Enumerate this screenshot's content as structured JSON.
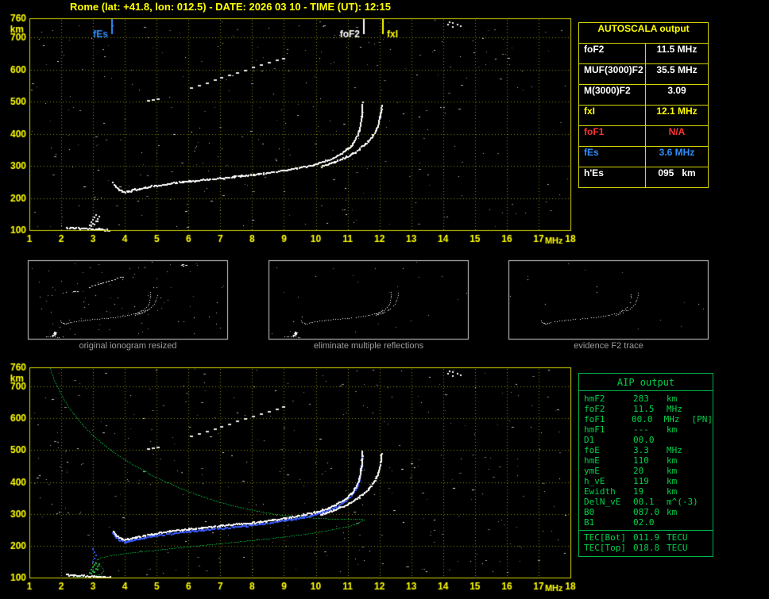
{
  "title": "Rome (lat: +41.8, lon: 012.5) - DATE: 2026 03 10 - TIME (UT): 12:15",
  "colors": {
    "axis_yellow": "#ffff00",
    "trace_white": "#ffffff",
    "profile_green": "#00d24a",
    "marker_blue": "#2f8fff",
    "error_red": "#ff3232",
    "caption_gray": "#9c9c9c"
  },
  "autoscala": {
    "header": "AUTOSCALA output",
    "rows": [
      {
        "label": "foF2",
        "value": "11.5 MHz",
        "color": "#ffffff"
      },
      {
        "label": "MUF(3000)F2",
        "value": "35.5 MHz",
        "color": "#ffffff"
      },
      {
        "label": "M(3000)F2",
        "value": "3.09",
        "color": "#ffffff"
      },
      {
        "label": "fxI",
        "value": "12.1 MHz",
        "color": "#ffff00"
      },
      {
        "label": "foF1",
        "value": "N/A",
        "color": "#ff3232"
      },
      {
        "label": "fEs",
        "value": "3.6 MHz",
        "color": "#2f8fff"
      },
      {
        "label": "h'Es",
        "value": "095   km",
        "color": "#ffffff"
      }
    ]
  },
  "aip": {
    "header": "AIP output",
    "rows": [
      {
        "label": "hmF2",
        "value": "283",
        "unit": "km"
      },
      {
        "label": "foF2",
        "value": "11.5",
        "unit": "MHz"
      },
      {
        "label": "foF1",
        "value": "00.0",
        "unit": "MHz",
        "extra": "[PN]"
      },
      {
        "label": "hmF1",
        "value": "---",
        "unit": "km"
      },
      {
        "label": "D1",
        "value": "00.0",
        "unit": ""
      },
      {
        "label": "foE",
        "value": "3.3",
        "unit": "MHz"
      },
      {
        "label": "hmE",
        "value": "110",
        "unit": "km"
      },
      {
        "label": "ymE",
        "value": "20",
        "unit": "km"
      },
      {
        "label": "h_vE",
        "value": "119",
        "unit": "km"
      },
      {
        "label": "Ewidth",
        "value": "19",
        "unit": "km"
      },
      {
        "label": "DelN_vE",
        "value": "00.1",
        "unit": "m^(-3)"
      },
      {
        "label": "B0",
        "value": "087.0",
        "unit": "km"
      },
      {
        "label": "B1",
        "value": "02.0",
        "unit": ""
      }
    ],
    "tec_rows": [
      {
        "label": "TEC[Bot]",
        "value": "011.9",
        "unit": "TECU"
      },
      {
        "label": "TEC[Top]",
        "value": "018.8",
        "unit": "TECU"
      }
    ]
  },
  "thumbnails": [
    {
      "caption": "original ionogram resized",
      "series": [
        "o_mode",
        "x_mode",
        "es_layer",
        "es_blob",
        "second_hop",
        "stray_cluster"
      ],
      "noise": 90
    },
    {
      "caption": "eliminate multiple reflections",
      "series": [
        "o_mode",
        "x_mode",
        "es_layer",
        "es_blob"
      ],
      "noise": 25
    },
    {
      "caption": "evidence F2 trace",
      "series": [
        "o_mode",
        "x_mode"
      ],
      "noise": 15
    }
  ],
  "chart_data": {
    "traces": {
      "o_mode": [
        [
          3.6,
          248
        ],
        [
          3.7,
          236
        ],
        [
          3.8,
          228
        ],
        [
          3.9,
          223
        ],
        [
          4.0,
          221
        ],
        [
          4.1,
          222
        ],
        [
          4.2,
          225
        ],
        [
          4.3,
          228
        ],
        [
          4.45,
          231
        ],
        [
          4.6,
          234
        ],
        [
          4.8,
          238
        ],
        [
          5.0,
          241
        ],
        [
          5.2,
          244
        ],
        [
          5.4,
          247
        ],
        [
          5.6,
          250
        ],
        [
          5.8,
          252
        ],
        [
          6.0,
          254
        ],
        [
          6.2,
          256
        ],
        [
          6.4,
          258
        ],
        [
          6.6,
          260
        ],
        [
          6.8,
          262
        ],
        [
          7.0,
          264
        ],
        [
          7.2,
          266
        ],
        [
          7.4,
          268
        ],
        [
          7.6,
          270
        ],
        [
          7.8,
          272
        ],
        [
          8.0,
          274
        ],
        [
          8.2,
          276
        ],
        [
          8.4,
          279
        ],
        [
          8.6,
          282
        ],
        [
          8.8,
          285
        ],
        [
          9.0,
          288
        ],
        [
          9.2,
          291
        ],
        [
          9.4,
          295
        ],
        [
          9.6,
          299
        ],
        [
          9.8,
          303
        ],
        [
          10.0,
          308
        ],
        [
          10.2,
          314
        ],
        [
          10.4,
          321
        ],
        [
          10.6,
          330
        ],
        [
          10.8,
          341
        ],
        [
          10.95,
          352
        ],
        [
          11.1,
          366
        ],
        [
          11.2,
          380
        ],
        [
          11.28,
          395
        ],
        [
          11.34,
          412
        ],
        [
          11.38,
          430
        ],
        [
          11.41,
          448
        ],
        [
          11.43,
          466
        ],
        [
          11.44,
          482
        ],
        [
          11.45,
          498
        ]
      ],
      "x_mode": [
        [
          10.15,
          300
        ],
        [
          10.35,
          306
        ],
        [
          10.55,
          313
        ],
        [
          10.75,
          321
        ],
        [
          10.95,
          330
        ],
        [
          11.15,
          341
        ],
        [
          11.35,
          354
        ],
        [
          11.5,
          367
        ],
        [
          11.65,
          381
        ],
        [
          11.78,
          397
        ],
        [
          11.88,
          415
        ],
        [
          11.95,
          433
        ],
        [
          12.0,
          453
        ],
        [
          12.03,
          473
        ],
        [
          12.05,
          492
        ]
      ],
      "es_layer": [
        [
          2.15,
          110
        ],
        [
          2.35,
          109
        ],
        [
          2.55,
          108
        ],
        [
          2.75,
          107
        ],
        [
          2.95,
          106
        ],
        [
          3.15,
          105
        ],
        [
          3.35,
          103
        ],
        [
          3.5,
          102
        ]
      ],
      "es_blob": [
        [
          2.9,
          116
        ],
        [
          2.95,
          124
        ],
        [
          3.0,
          132
        ],
        [
          3.05,
          140
        ],
        [
          3.1,
          146
        ],
        [
          3.0,
          120
        ],
        [
          3.1,
          128
        ],
        [
          3.15,
          135
        ],
        [
          2.95,
          112
        ],
        [
          3.2,
          142
        ],
        [
          3.05,
          118
        ],
        [
          3.15,
          126
        ]
      ],
      "second_hop": [
        [
          4.75,
          505
        ],
        [
          4.9,
          508
        ],
        [
          5.05,
          510
        ],
        [
          6.1,
          545
        ],
        [
          6.35,
          553
        ],
        [
          6.6,
          561
        ],
        [
          6.85,
          569
        ],
        [
          7.05,
          576
        ],
        [
          7.3,
          584
        ],
        [
          7.55,
          592
        ],
        [
          7.8,
          600
        ],
        [
          8.05,
          608
        ],
        [
          8.3,
          616
        ],
        [
          8.55,
          624
        ],
        [
          8.8,
          631
        ],
        [
          9.0,
          637
        ]
      ],
      "stray_cluster": [
        [
          14.15,
          740
        ],
        [
          14.3,
          744
        ],
        [
          14.45,
          739
        ],
        [
          14.3,
          733
        ],
        [
          14.55,
          736
        ],
        [
          14.2,
          747
        ]
      ],
      "profile": [
        [
          1.65,
          758
        ],
        [
          1.7,
          740
        ],
        [
          1.78,
          720
        ],
        [
          1.87,
          700
        ],
        [
          1.97,
          680
        ],
        [
          2.08,
          660
        ],
        [
          2.2,
          640
        ],
        [
          2.34,
          620
        ],
        [
          2.5,
          600
        ],
        [
          2.67,
          580
        ],
        [
          2.86,
          560
        ],
        [
          3.07,
          540
        ],
        [
          3.3,
          520
        ],
        [
          3.56,
          500
        ],
        [
          3.85,
          480
        ],
        [
          4.17,
          460
        ],
        [
          4.52,
          440
        ],
        [
          4.9,
          420
        ],
        [
          5.32,
          400
        ],
        [
          5.78,
          380
        ],
        [
          6.28,
          360
        ],
        [
          6.82,
          342
        ],
        [
          7.4,
          326
        ],
        [
          8.0,
          312
        ],
        [
          8.62,
          301
        ],
        [
          9.25,
          293
        ],
        [
          9.9,
          288
        ],
        [
          10.5,
          285
        ],
        [
          11.0,
          284
        ],
        [
          11.35,
          284
        ],
        [
          11.5,
          283
        ],
        [
          11.42,
          277
        ],
        [
          11.3,
          271
        ],
        [
          11.1,
          264
        ],
        [
          10.8,
          257
        ],
        [
          10.45,
          250
        ],
        [
          10.05,
          243
        ],
        [
          9.6,
          236
        ],
        [
          9.1,
          230
        ],
        [
          8.55,
          223
        ],
        [
          7.95,
          217
        ],
        [
          7.35,
          211
        ],
        [
          6.75,
          205
        ],
        [
          6.15,
          199
        ],
        [
          5.55,
          193
        ],
        [
          5.0,
          187
        ],
        [
          4.5,
          182
        ],
        [
          4.05,
          177
        ],
        [
          3.68,
          172
        ],
        [
          3.4,
          167
        ],
        [
          3.22,
          162
        ],
        [
          3.12,
          157
        ],
        [
          3.08,
          151
        ],
        [
          3.1,
          146
        ],
        [
          3.16,
          141
        ],
        [
          3.24,
          136
        ],
        [
          3.3,
          131
        ],
        [
          3.33,
          126
        ],
        [
          3.32,
          121
        ],
        [
          3.28,
          116
        ],
        [
          3.2,
          111
        ],
        [
          3.05,
          107
        ],
        [
          2.8,
          104
        ],
        [
          2.5,
          102
        ],
        [
          2.15,
          100
        ]
      ],
      "blue_spur": [
        [
          3.0,
          150
        ],
        [
          3.05,
          160
        ],
        [
          3.1,
          170
        ],
        [
          3.05,
          180
        ],
        [
          3.0,
          190
        ]
      ]
    },
    "charts": [
      {
        "type": "scatter",
        "name": "scaled ionogram",
        "xlabel": "MHz",
        "ylabel": "km",
        "xlim": [
          1,
          18
        ],
        "ylim": [
          100,
          760
        ],
        "xticks": [
          1,
          2,
          3,
          4,
          5,
          6,
          7,
          8,
          9,
          10,
          11,
          12,
          13,
          14,
          15,
          16,
          17,
          18
        ],
        "yticks": [
          760,
          700,
          600,
          500,
          400,
          300,
          200,
          100
        ],
        "grid": true,
        "markers": [
          {
            "label": "fEs",
            "freq": 3.6,
            "color": "#2f8fff",
            "side": "left"
          },
          {
            "label": "foF2",
            "freq": 11.5,
            "color": "#ffffff",
            "side": "left"
          },
          {
            "label": "fxI",
            "freq": 12.1,
            "color": "#ffff00",
            "side": "right"
          }
        ],
        "series": [
          {
            "name": "F trace o-mode",
            "trace": "o_mode",
            "color": "#ffffff",
            "style": "line"
          },
          {
            "name": "F trace x-mode",
            "trace": "x_mode",
            "color": "#ffffff",
            "style": "line"
          },
          {
            "name": "Es trace",
            "trace": "es_layer",
            "color": "#ffffff",
            "style": "line"
          },
          {
            "name": "Es blob",
            "trace": "es_blob",
            "color": "#ffffff",
            "style": "dots"
          },
          {
            "name": "second hop echoes",
            "trace": "second_hop",
            "color": "#e8e8e8",
            "style": "dash"
          },
          {
            "name": "interference cluster",
            "trace": "stray_cluster",
            "color": "#ffffff",
            "style": "dots"
          }
        ],
        "noise": {
          "count": 300,
          "seed": 7
        }
      },
      {
        "type": "scatter",
        "name": "ionogram with restored trace and electron density profile",
        "xlabel": "MHz",
        "ylabel": "km",
        "xlim": [
          1,
          18
        ],
        "ylim": [
          100,
          760
        ],
        "xticks": [
          1,
          2,
          3,
          4,
          5,
          6,
          7,
          8,
          9,
          10,
          11,
          12,
          13,
          14,
          15,
          16,
          17,
          18
        ],
        "yticks": [
          760,
          700,
          600,
          500,
          400,
          300,
          200,
          100
        ],
        "grid": true,
        "markers": [],
        "series": [
          {
            "name": "electron density profile",
            "trace": "profile",
            "color": "#00d24a",
            "style": "dotted"
          },
          {
            "name": "restored trace",
            "trace": "o_mode",
            "color": "#3a5cff",
            "style": "line",
            "dy": 3
          },
          {
            "name": "F trace o-mode",
            "trace": "o_mode",
            "color": "#ffffff",
            "style": "line"
          },
          {
            "name": "F trace x-mode",
            "trace": "x_mode",
            "color": "#ffffff",
            "style": "line"
          },
          {
            "name": "Es trace",
            "trace": "es_layer",
            "color": "#ffffff",
            "style": "line"
          },
          {
            "name": "Es blob",
            "trace": "es_blob",
            "color": "#20c040",
            "style": "dots"
          },
          {
            "name": "blue spur",
            "trace": "blue_spur",
            "color": "#3a5cff",
            "style": "dots"
          },
          {
            "name": "second hop echoes",
            "trace": "second_hop",
            "color": "#e8e8e8",
            "style": "dash"
          },
          {
            "name": "interference cluster",
            "trace": "stray_cluster",
            "color": "#ffffff",
            "style": "dots"
          }
        ],
        "noise": {
          "count": 330,
          "seed": 13
        }
      }
    ]
  }
}
